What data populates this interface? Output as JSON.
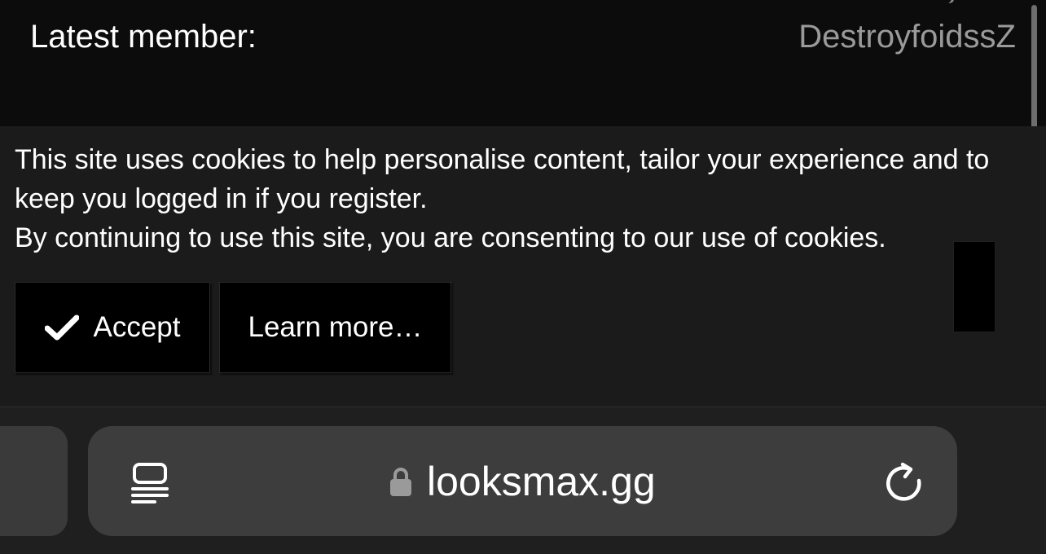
{
  "stats": {
    "latest_member_label": "Latest member:",
    "latest_member_value": "DestroyfoidssZ"
  },
  "cookie_notice": {
    "line1": "This site uses cookies to help personalise content, tailor your experience and to keep you logged in if you register.",
    "line2": "By continuing to use this site, you are consenting to our use of cookies.",
    "accept_label": "Accept",
    "learn_more_label": "Learn more…"
  },
  "browser": {
    "url": "looksmax.gg",
    "icons": [
      "reader-mode-icon",
      "lock-icon",
      "reload-icon",
      "check-icon"
    ]
  },
  "colors": {
    "background": "#0c0c0c",
    "cookie_bg": "#1b1b1b",
    "button_bg": "#000000",
    "urlbar_bg": "#3d3d3d",
    "muted_text": "#9a9a9a"
  }
}
